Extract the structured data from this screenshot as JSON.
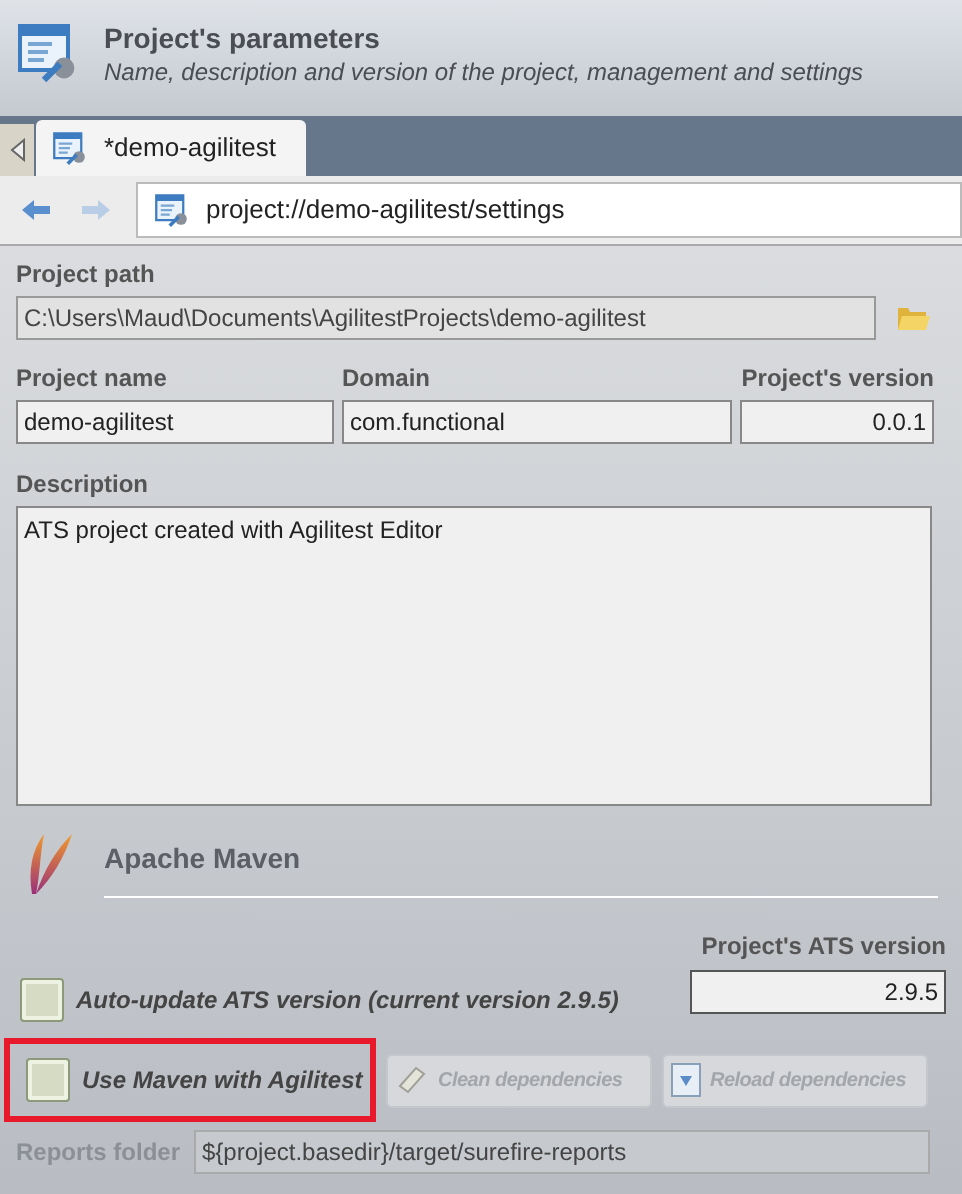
{
  "header": {
    "title": "Project's parameters",
    "subtitle": "Name, description and version of the project, management and settings"
  },
  "tabs": [
    {
      "label": "*demo-agilitest",
      "selected": true
    }
  ],
  "address": "project://demo-agilitest/settings",
  "project_path": {
    "label": "Project path",
    "value": "C:\\Users\\Maud\\Documents\\AgilitestProjects\\demo-agilitest"
  },
  "fields": [
    {
      "label": "Project name",
      "value": "demo-agilitest"
    },
    {
      "label": "Domain",
      "value": "com.functional"
    },
    {
      "label": "Project's version",
      "value": "0.0.1"
    }
  ],
  "description": {
    "label": "Description",
    "value": "ATS project created with Agilitest Editor"
  },
  "maven": {
    "title": "Apache Maven",
    "ats_version_label": "Project's ATS version",
    "ats_version": "2.9.5",
    "auto_update": {
      "label": "Auto-update ATS version (current version 2.9.5)",
      "checked": false
    },
    "use_maven": {
      "label": "Use Maven with Agilitest",
      "checked": false,
      "highlighted": true
    },
    "buttons": [
      {
        "label": "Clean dependencies",
        "kind": "clean",
        "disabled": true
      },
      {
        "label": "Reload dependencies",
        "kind": "reload",
        "disabled": true
      }
    ],
    "reports_folder": {
      "label": "Reports folder",
      "value": "${project.basedir}/target/surefire-reports",
      "disabled": true
    }
  }
}
